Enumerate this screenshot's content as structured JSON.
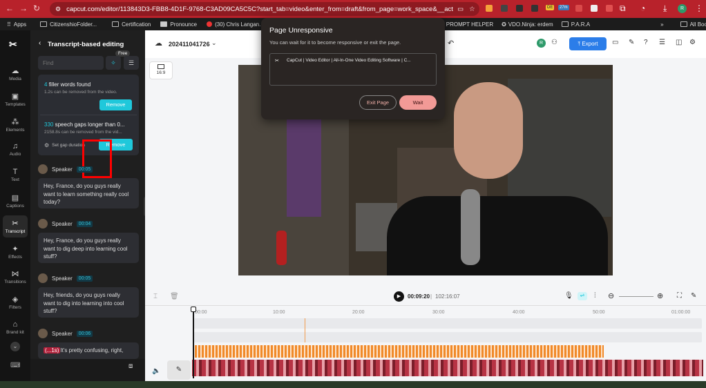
{
  "browser": {
    "url": "capcut.com/editor/113843D3-FBB8-4D1F-9768-C3AD09CA5C5C?start_tab=video&enter_from=draft&from_page=work_space&__action_fr...",
    "ext_badge_1": "DE",
    "ext_badge_2": "27m",
    "profile_letter": "R"
  },
  "bookmarks": [
    "Apps",
    "CitizenshioFolder...",
    "Certification",
    "Pronounce",
    "(30) Chris Langan...",
    "PROMPT HELPER",
    "VDO.Ninja: erdem",
    "P.A.R.A",
    "All Bookmarks"
  ],
  "leftnav": [
    "Media",
    "Templates",
    "Elements",
    "Audio",
    "Text",
    "Captions",
    "Transcript",
    "Effects",
    "Transitions",
    "Filters",
    "Brand kit"
  ],
  "panel": {
    "title": "Transcript-based editing",
    "free_badge": "Free",
    "find_placeholder": "Find",
    "filler_count": "4",
    "filler_text": "filler words found",
    "filler_sub": "1.2s can be removed from the video.",
    "remove_label": "Remove",
    "gaps_count": "330",
    "gaps_text": "speech gaps longer than 0...",
    "gaps_sub": "2158.8s can be removed from the vid...",
    "set_gap_label": "Set gap duration",
    "remove2_label": "Remove",
    "transcript": [
      {
        "speaker": "Speaker",
        "time": "00:05",
        "text": "Hey, France, do you guys really want to learn something really cool today?"
      },
      {
        "speaker": "Speaker",
        "time": "00:04",
        "text": "Hey, France, do you guys really want to dig deep into learning cool stuff?"
      },
      {
        "speaker": "Speaker",
        "time": "00:05",
        "text": "Hey, friends, do you guys really want to dig into learning into cool stuff?"
      },
      {
        "speaker": "Speaker",
        "time": "00:06",
        "text": "It's pretty confusing, right,"
      }
    ],
    "last_tag": "(...1s)"
  },
  "editor": {
    "project_name": "202411041726",
    "export_label": "Export",
    "avatar_letter": "R",
    "ratio_label": "16:9",
    "current_time": "00:09:20",
    "total_time": "102:16:07",
    "ticks": [
      "00:00",
      "10:00",
      "20:00",
      "30:00",
      "40:00",
      "50:00",
      "01:00:00"
    ]
  },
  "dialog": {
    "title": "Page Unresponsive",
    "message": "You can wait for it to become responsive or exit the page.",
    "page_item": "CapCut | Video Editor | All-In-One Video Editing Software | C...",
    "exit_label": "Exit Page",
    "wait_label": "Wait"
  },
  "colors": {
    "accent": "#1fc8db",
    "export_blue": "#2b7de9",
    "browser_red": "#b8222b",
    "wait_pink": "#f29a96",
    "highlight_red": "#ff0000"
  }
}
